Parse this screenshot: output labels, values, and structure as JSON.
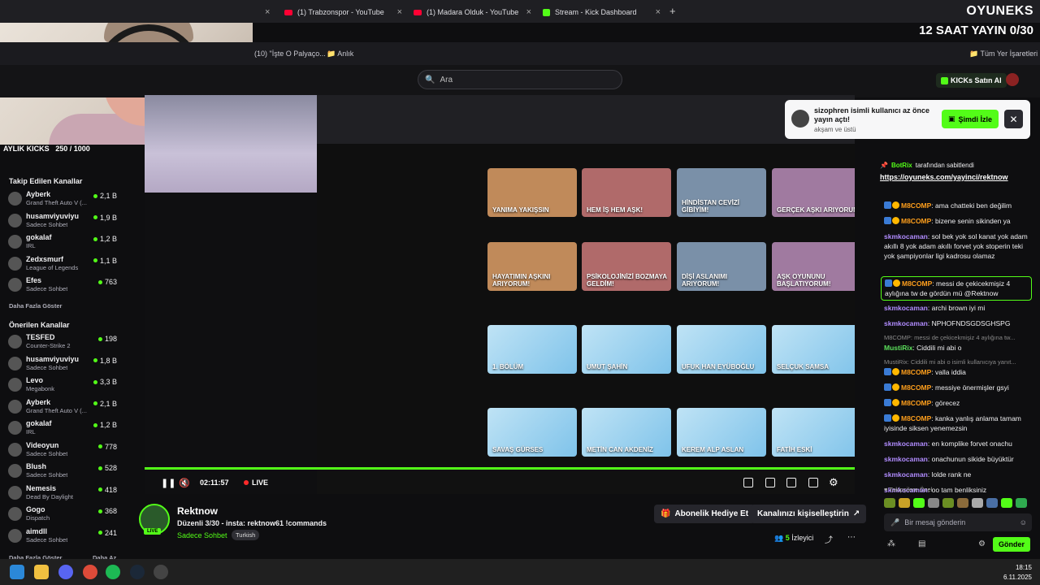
{
  "browser": {
    "tabs": [
      {
        "label": "(1) Trabzonspor - YouTube",
        "type": "youtube"
      },
      {
        "label": "(1) Madara Olduk - YouTube",
        "type": "youtube"
      },
      {
        "label": "Stream - Kick Dashboard",
        "type": "kick"
      }
    ],
    "bookmarks": [
      {
        "label": "(10) \"İşte O Palyaço..."
      },
      {
        "label": "Anlık"
      },
      {
        "label": "Tüm Yer İşaretleri"
      }
    ]
  },
  "overlay": {
    "brand": "OYUNEKS",
    "banner": "12 SAAT YAYIN 0/30",
    "sub_goal_label": "AYLIK KICKS",
    "sub_goal_value": "250 / 1000"
  },
  "kick": {
    "search_placeholder": "Ara",
    "kicks_button": "KICKs Satın Al"
  },
  "notification": {
    "text": "sizophren isimli kullanıcı az önce yayın açtı!",
    "sub": "akşam ve üstü",
    "watch": "Şimdi İzle"
  },
  "sidebar": {
    "followed_title": "Takip Edilen Kanallar",
    "followed": [
      {
        "name": "Ayberk",
        "category": "Grand Theft Auto V (...",
        "viewers": "2,1 B"
      },
      {
        "name": "husamviyuviyu",
        "category": "Sadece Sohbet",
        "viewers": "1,9 B"
      },
      {
        "name": "gokalaf",
        "category": "IRL",
        "viewers": "1,2 B"
      },
      {
        "name": "Zedxsmurf",
        "category": "League of Legends",
        "viewers": "1,1 B"
      },
      {
        "name": "Efes",
        "category": "Sadece Sohbet",
        "viewers": "763"
      }
    ],
    "show_more": "Daha Fazla Göster",
    "recommended_title": "Önerilen Kanallar",
    "recommended": [
      {
        "name": "TESFED",
        "category": "Counter-Strike 2",
        "viewers": "198"
      },
      {
        "name": "husamviyuviyu",
        "category": "Sadece Sohbet",
        "viewers": "1,8 B"
      },
      {
        "name": "Levo",
        "category": "Megabonk",
        "viewers": "3,3 B"
      },
      {
        "name": "Ayberk",
        "category": "Grand Theft Auto V (...",
        "viewers": "2,1 B"
      },
      {
        "name": "gokalaf",
        "category": "IRL",
        "viewers": "1,2 B"
      },
      {
        "name": "Videoyun",
        "category": "Sadece Sohbet",
        "viewers": "778"
      },
      {
        "name": "Blush",
        "category": "Sadece Sohbet",
        "viewers": "528"
      },
      {
        "name": "Nemesis",
        "category": "Dead By Daylight",
        "viewers": "418"
      },
      {
        "name": "Gogo",
        "category": "Dispatch",
        "viewers": "368"
      },
      {
        "name": "aimdll",
        "category": "Sadece Sohbet",
        "viewers": "241"
      }
    ],
    "show_more_2": "Daha Fazla Göster",
    "show_less": "Daha Az"
  },
  "video": {
    "time": "02:11:57",
    "live": "LIVE",
    "thumbs": [
      {
        "title": "YANIMA YAKIŞSIN"
      },
      {
        "title": "HEM İŞ HEM AŞK!"
      },
      {
        "title": "HİNDİSTAN CEVİZİ GİBİYİM!"
      },
      {
        "title": "GERÇEK AŞKI ARIYORUM!"
      },
      {
        "title": "HAYATIMIN AŞKINI ARIYORUM!"
      },
      {
        "title": "PSİKOLOJİNİZİ BOZMAYA GELDİM!"
      },
      {
        "title": "DİŞİ ASLANIMI ARIYORUM!"
      },
      {
        "title": "AŞK OYUNUNU BAŞLATIYORUM!"
      },
      {
        "title": "1. BÖLÜM"
      },
      {
        "title": "UMUT ŞAHİN"
      },
      {
        "title": "UFUK HAN EYÜBOĞLU"
      },
      {
        "title": "SELÇUK SAMSA"
      },
      {
        "title": "SAVAŞ GÜRSES"
      },
      {
        "title": "METİN CAN AKDENİZ"
      },
      {
        "title": "KEREM ALP ASLAN"
      },
      {
        "title": "FATİH ESKİ"
      }
    ]
  },
  "stream": {
    "name": "Rektnow",
    "title": "Düzenli 3/30 - insta: rektnow61 !commands",
    "category": "Sadece Sohbet",
    "tag": "Turkish",
    "live_badge": "LIVE",
    "gift_button": "Abonelik Hediye Et",
    "customize_button": "Kanalınızı kişiselleştirin",
    "viewers_count": "5",
    "viewers_label": "İzleyici"
  },
  "chat": {
    "pinned_by": "BotRix",
    "pinned_text": "tarafından sabitlendi",
    "pinned_link": "https://oyuneks.com/yayinci/rektnow",
    "messages": [
      {
        "user": "M8COMP",
        "text": "ama chatteki ben değilim",
        "cls": "u-m8",
        "badges": true
      },
      {
        "user": "M8COMP",
        "text": "bizene senin sikinden ya",
        "cls": "u-m8",
        "badges": true
      },
      {
        "user": "skmkocaman",
        "text": "sol bek yok sol kanat yok adam akıllı 8 yok adam akıllı forvet yok stoperin teki yok şampiyonlar ligi kadrosu olamaz",
        "cls": "u-skm",
        "badges": false
      },
      {
        "user": "M8COMP",
        "text": "messi de çekicekmişiz 4 aylığına tw de gördün mü @Rektnow",
        "cls": "u-m8",
        "badges": true,
        "highlight": true
      },
      {
        "user": "skmkocaman",
        "text": "archi brown iyi mi",
        "cls": "u-skm",
        "badges": false
      },
      {
        "user": "skmkocaman",
        "text": "NPHOFNDSGDSGHSPG",
        "cls": "u-skm",
        "badges": false
      },
      {
        "user": "MustiRix",
        "text": "Ciddili mi abi o",
        "cls": "u-mus",
        "badges": false,
        "reply": "M8COMP: messi de çekicekmişiz 4 aylığına tw..."
      },
      {
        "user": "M8COMP",
        "text": "valla iddia",
        "cls": "u-m8",
        "badges": true,
        "reply": "MustiRix: Ciddili mi abi o isimli kullanıcıya yanıt..."
      },
      {
        "user": "M8COMP",
        "text": "messiye önermişler gsyi",
        "cls": "u-m8",
        "badges": true
      },
      {
        "user": "M8COMP",
        "text": "görecez",
        "cls": "u-m8",
        "badges": true
      },
      {
        "user": "M8COMP",
        "text": "kanka yanlış anlama tamam iyisinde siksen yenemezsin",
        "cls": "u-m8",
        "badges": true
      },
      {
        "user": "skmkocaman",
        "text": "en komplike forvet onachu",
        "cls": "u-skm",
        "badges": false
      },
      {
        "user": "skmkocaman",
        "text": "onachunun sikide büyüktür",
        "cls": "u-skm",
        "badges": false
      },
      {
        "user": "skmkocaman",
        "text": "lolde rank ne",
        "cls": "u-skm",
        "badges": false
      },
      {
        "user": "skmkocaman",
        "text": "oo tam benliksiniz",
        "cls": "u-skm",
        "badges": false
      }
    ],
    "followers_only": "Takipçilere Özel",
    "input_placeholder": "Bir mesaj gönderin",
    "send": "Gönder"
  },
  "taskbar": {
    "time": "18:15",
    "date": "6.11.2025"
  },
  "colors": {
    "kick_green": "#53fc18",
    "youtube_red": "#ff0033",
    "bg": "#0e0e10"
  }
}
